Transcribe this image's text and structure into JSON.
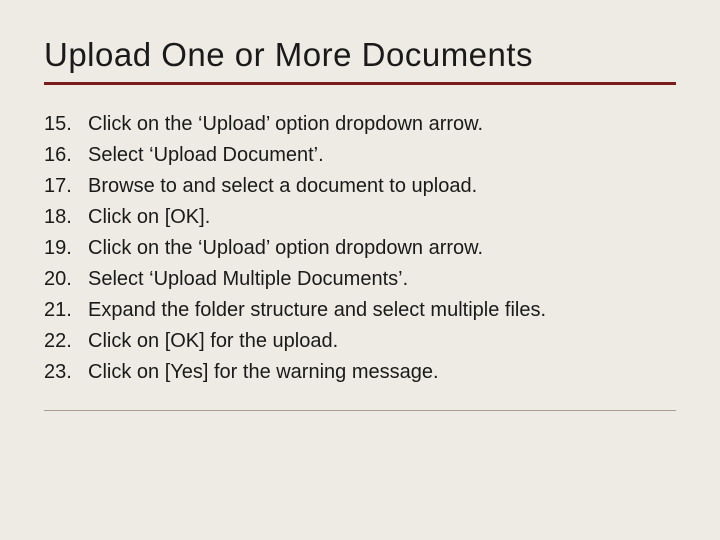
{
  "title": "Upload One or More Documents",
  "steps": [
    {
      "n": "15.",
      "t": "Click on the ‘Upload’ option dropdown arrow."
    },
    {
      "n": "16.",
      "t": "Select ‘Upload Document’."
    },
    {
      "n": "17.",
      "t": "Browse to and select a document to upload."
    },
    {
      "n": "18.",
      "t": "Click on [OK]."
    },
    {
      "n": "19.",
      "t": "Click on the ‘Upload’ option dropdown arrow."
    },
    {
      "n": "20.",
      "t": "Select ‘Upload Multiple Documents’."
    },
    {
      "n": "21.",
      "t": "Expand the folder structure and select multiple files."
    },
    {
      "n": "22.",
      "t": "Click on [OK] for the upload."
    },
    {
      "n": "23.",
      "t": "Click on [Yes] for the warning message."
    }
  ]
}
